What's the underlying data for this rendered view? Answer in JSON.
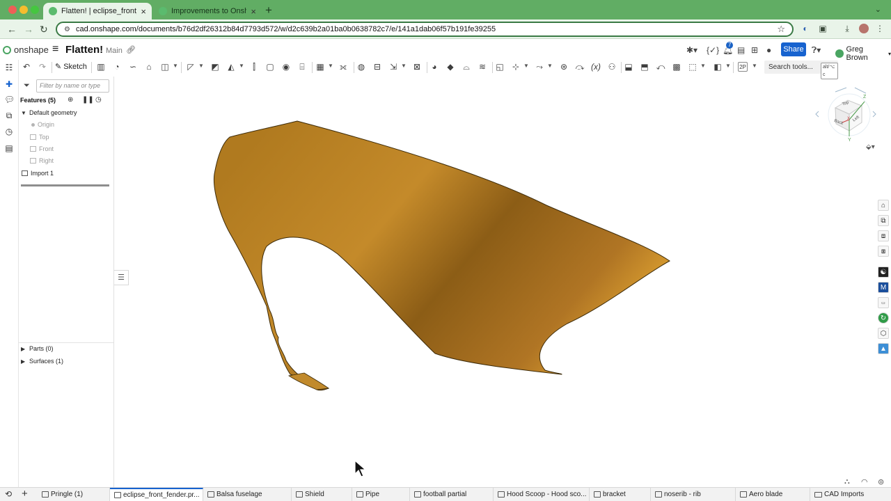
{
  "browser": {
    "tabs": [
      {
        "title": "Flatten! | eclipse_front_fende",
        "active": true
      },
      {
        "title": "Improvements to Onshape - J",
        "active": false
      }
    ],
    "url": "cad.onshape.com/documents/b76d2df26312b84d7793d572/w/d2c639b2a01ba0b0638782c7/e/141a1dab06f57b191fe39255"
  },
  "header": {
    "logo": "onshape",
    "title": "Flatten!",
    "branch": "Main",
    "notifications_count": "7",
    "share_label": "Share",
    "user_name": "Greg Brown"
  },
  "toolbar": {
    "sketch_label": "Sketch",
    "search_label": "Search tools...",
    "search_shortcut": "alt/⌥ c"
  },
  "panel": {
    "filter_placeholder": "Filter by name or type",
    "features_header": "Features (5)",
    "default_geometry": "Default geometry",
    "origin": "Origin",
    "planes": [
      "Top",
      "Front",
      "Right"
    ],
    "import": "Import 1",
    "parts": "Parts (0)",
    "surfaces": "Surfaces (1)"
  },
  "viewcube": {
    "faces": [
      "Top",
      "Back",
      "Left"
    ],
    "axes": [
      "X",
      "Y",
      "Z"
    ]
  },
  "bottom_tabs": [
    {
      "label": "Pringle (1)",
      "active": false
    },
    {
      "label": "eclipse_front_fender.pr...",
      "active": true
    },
    {
      "label": "Balsa fuselage",
      "active": false
    },
    {
      "label": "Shield",
      "active": false
    },
    {
      "label": "Pipe",
      "active": false
    },
    {
      "label": "football partial",
      "active": false
    },
    {
      "label": "Hood Scoop - Hood sco...",
      "active": false
    },
    {
      "label": "bracket",
      "active": false
    },
    {
      "label": "noserib - rib",
      "active": false
    },
    {
      "label": "Aero blade",
      "active": false
    },
    {
      "label": "CAD Imports",
      "active": false
    }
  ],
  "colors": {
    "browser_frame": "#61ad64",
    "share_button": "#1763cf",
    "surface": "#c8892a"
  }
}
